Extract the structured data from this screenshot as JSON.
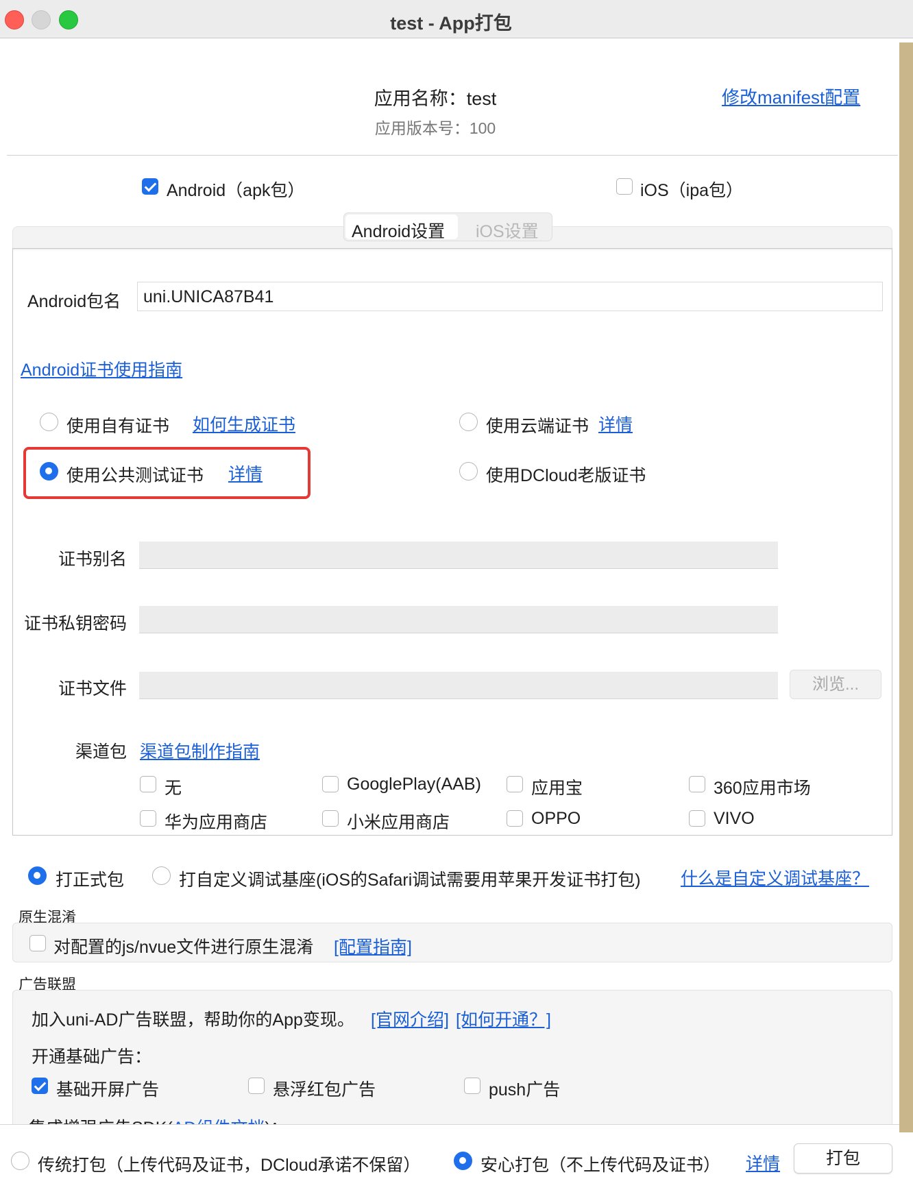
{
  "window": {
    "title": "test - App打包"
  },
  "header": {
    "app_name": "应用名称：test",
    "app_version": "应用版本号：100",
    "manifest_link": "修改manifest配置"
  },
  "platforms": {
    "android": {
      "label": "Android（apk包）",
      "checked": true
    },
    "ios": {
      "label": "iOS（ipa包）",
      "checked": false
    }
  },
  "tabs": [
    {
      "label": "Android设置",
      "active": true
    },
    {
      "label": "iOS设置",
      "active": false
    }
  ],
  "android": {
    "package_label": "Android包名",
    "package_value": "uni.UNICA87B41",
    "cert_guide_link": "Android证书使用指南",
    "cert_options": {
      "own": {
        "label": "使用自有证书",
        "link": "如何生成证书",
        "selected": false
      },
      "cloud": {
        "label": "使用云端证书",
        "link": "详情",
        "selected": false
      },
      "public_test": {
        "label": "使用公共测试证书",
        "link": "详情",
        "selected": true
      },
      "dcloud_old": {
        "label": "使用DCloud老版证书",
        "selected": false
      }
    },
    "cert_alias_label": "证书别名",
    "cert_password_label": "证书私钥密码",
    "cert_file_label": "证书文件",
    "browse_button": "浏览...",
    "channel_label": "渠道包",
    "channel_guide_link": "渠道包制作指南",
    "channels": [
      "无",
      "GooglePlay(AAB)",
      "应用宝",
      "360应用市场",
      "华为应用商店",
      "小米应用商店",
      "OPPO",
      "VIVO"
    ]
  },
  "build_type": {
    "release": {
      "label": "打正式包",
      "selected": true
    },
    "custom_base": {
      "label": "打自定义调试基座(iOS的Safari调试需要用苹果开发证书打包)",
      "selected": false
    },
    "help_link": "什么是自定义调试基座？"
  },
  "obfuscation": {
    "section_title": "原生混淆",
    "checkbox_label": "对配置的js/nvue文件进行原生混淆",
    "guide_link": "[配置指南]"
  },
  "ads": {
    "section_title": "广告联盟",
    "intro": "加入uni-AD广告联盟，帮助你的App变现。",
    "intro_link_1": "[官网介绍]",
    "intro_link_2": "[如何开通？]",
    "basic_title": "开通基础广告：",
    "options": [
      {
        "label": "基础开屏广告",
        "checked": true
      },
      {
        "label": "悬浮红包广告",
        "checked": false
      },
      {
        "label": "push广告",
        "checked": false
      }
    ],
    "enhanced_prefix": "集成增强广告SDK(",
    "enhanced_link": "AD组件文档",
    "enhanced_suffix": ")："
  },
  "footer": {
    "traditional": {
      "label": "传统打包（上传代码及证书，DCloud承诺不保留）",
      "selected": false
    },
    "safe": {
      "label": "安心打包（不上传代码及证书）",
      "selected": true
    },
    "detail_link": "详情",
    "pack_button": "打包"
  }
}
